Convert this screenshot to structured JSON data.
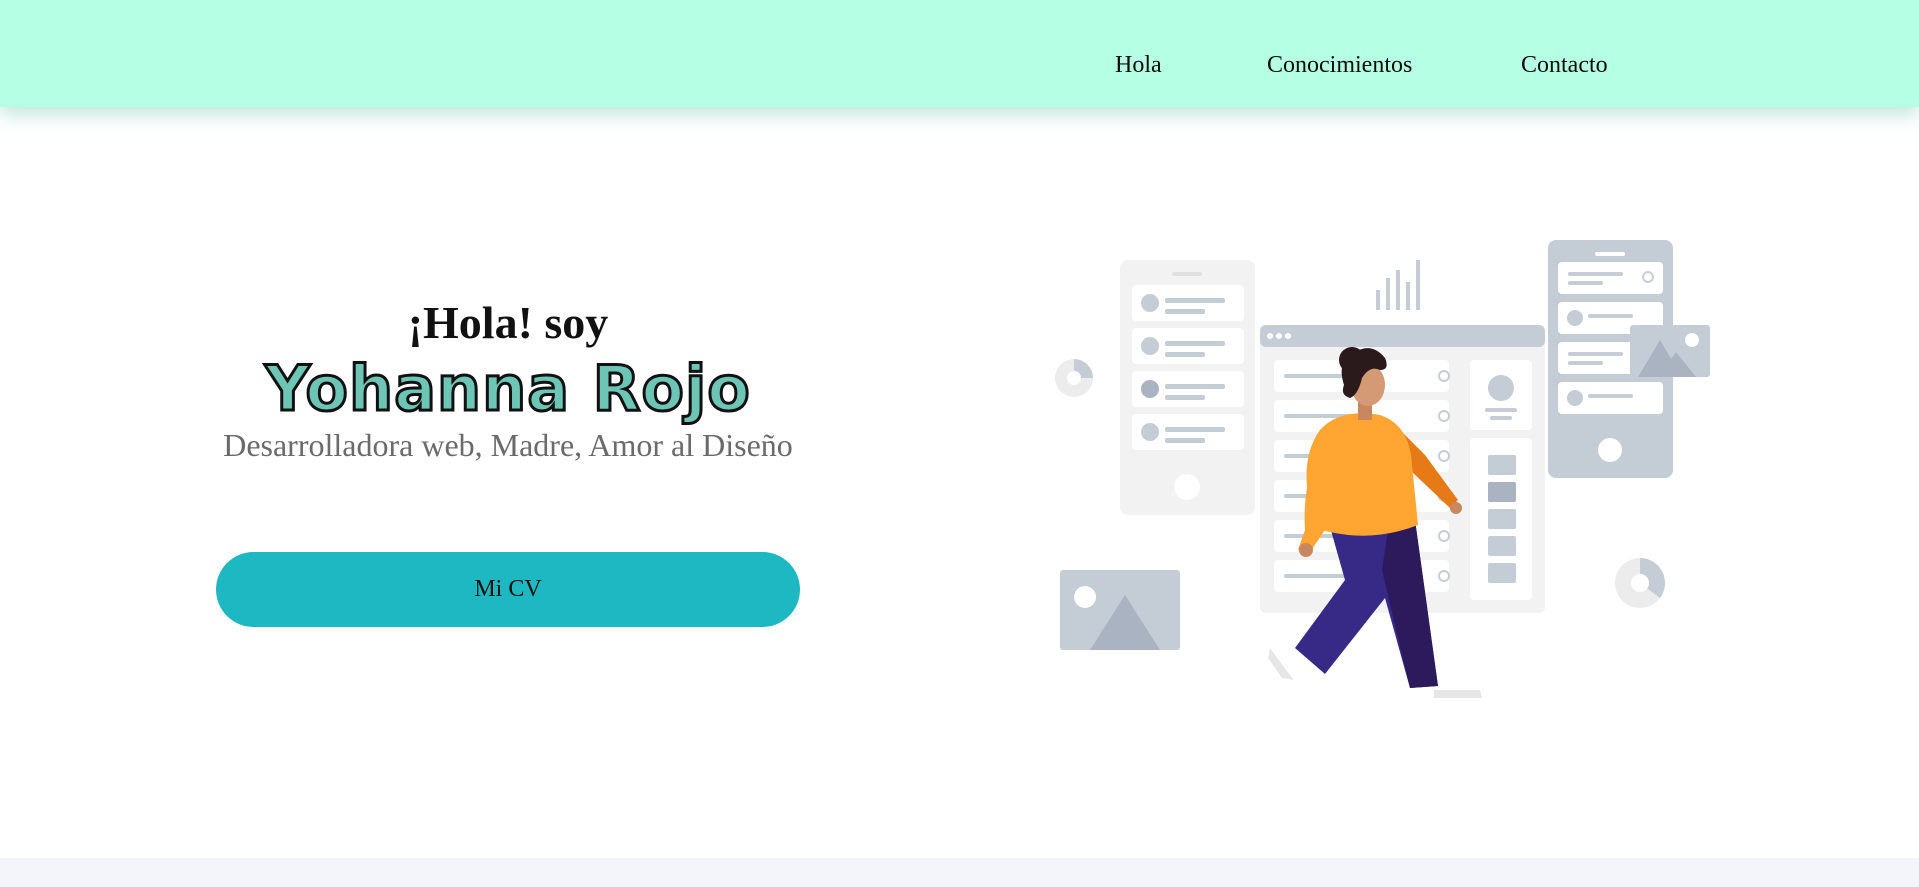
{
  "nav": {
    "links": [
      {
        "label": "Hola"
      },
      {
        "label": "Conocimientos"
      },
      {
        "label": "Contacto"
      }
    ]
  },
  "hero": {
    "greeting": "¡Hola! soy",
    "name": "Yohanna Rojo",
    "tagline": "Desarrolladora web, Madre, Amor al Diseño",
    "cv_button_label": "Mi CV"
  },
  "colors": {
    "navbar": "#b5ffe4",
    "name_fill": "#6dc5b6",
    "button": "#1db8c2",
    "tagline": "#6a6a6a"
  },
  "illustration": {
    "icon": "woman-walking-dashboard-illustration"
  }
}
